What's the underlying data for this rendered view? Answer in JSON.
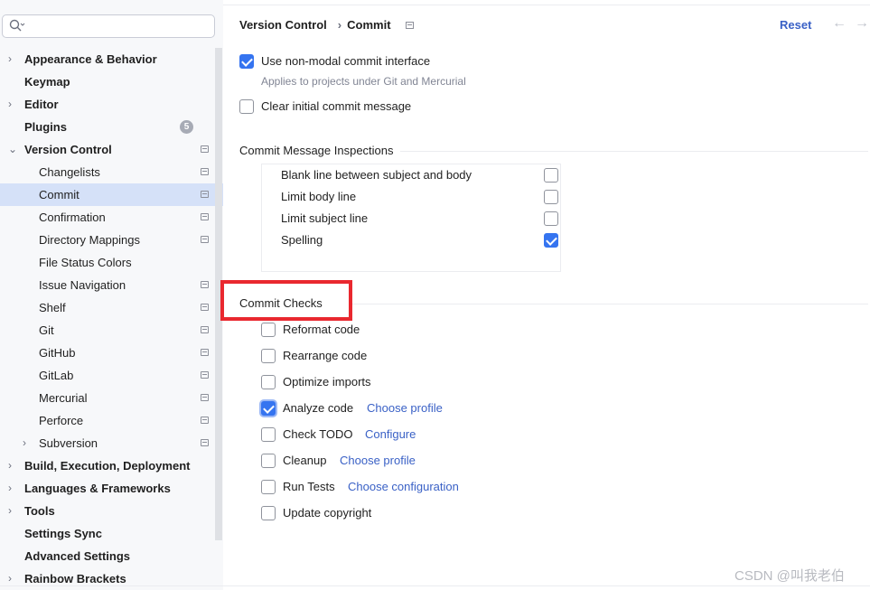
{
  "search": {
    "placeholder": ""
  },
  "tree": [
    {
      "label": "Appearance & Behavior",
      "level": 0,
      "chevron": true
    },
    {
      "label": "Keymap",
      "level": 0
    },
    {
      "label": "Editor",
      "level": 0,
      "chevron": true
    },
    {
      "label": "Plugins",
      "level": 0,
      "badge": "5"
    },
    {
      "label": "Version Control",
      "level": 0,
      "expanded": true,
      "page_icon": true
    },
    {
      "label": "Changelists",
      "level": 1,
      "page_icon": true
    },
    {
      "label": "Commit",
      "level": 1,
      "page_icon": true,
      "selected": true
    },
    {
      "label": "Confirmation",
      "level": 1,
      "page_icon": true
    },
    {
      "label": "Directory Mappings",
      "level": 1,
      "page_icon": true
    },
    {
      "label": "File Status Colors",
      "level": 1
    },
    {
      "label": "Issue Navigation",
      "level": 1,
      "page_icon": true
    },
    {
      "label": "Shelf",
      "level": 1,
      "page_icon": true
    },
    {
      "label": "Git",
      "level": 1,
      "page_icon": true
    },
    {
      "label": "GitHub",
      "level": 1,
      "page_icon": true
    },
    {
      "label": "GitLab",
      "level": 1,
      "page_icon": true
    },
    {
      "label": "Mercurial",
      "level": 1,
      "page_icon": true
    },
    {
      "label": "Perforce",
      "level": 1,
      "page_icon": true
    },
    {
      "label": "Subversion",
      "level": 1,
      "chevron": true,
      "page_icon": true
    },
    {
      "label": "Build, Execution, Deployment",
      "level": 0,
      "chevron": true
    },
    {
      "label": "Languages & Frameworks",
      "level": 0,
      "chevron": true
    },
    {
      "label": "Tools",
      "level": 0,
      "chevron": true
    },
    {
      "label": "Settings Sync",
      "level": 0
    },
    {
      "label": "Advanced Settings",
      "level": 0
    },
    {
      "label": "Rainbow Brackets",
      "level": 0,
      "chevron": true
    }
  ],
  "header": {
    "crumb_parent": "Version Control",
    "crumb_separator": "›",
    "crumb_current": "Commit",
    "reset": "Reset",
    "back_icon": "←",
    "forward_icon": "→"
  },
  "options": {
    "non_modal": {
      "label": "Use non-modal commit interface",
      "checked": true,
      "hint": "Applies to projects under Git and Mercurial"
    },
    "clear_initial": {
      "label": "Clear initial commit message",
      "checked": false
    }
  },
  "inspections": {
    "title": "Commit Message Inspections",
    "items": [
      {
        "label": "Blank line between subject and body",
        "checked": false
      },
      {
        "label": "Limit body line",
        "checked": false
      },
      {
        "label": "Limit subject line",
        "checked": false
      },
      {
        "label": "Spelling",
        "checked": true
      }
    ]
  },
  "checks": {
    "title": "Commit Checks",
    "items": [
      {
        "label": "Reformat code",
        "checked": false,
        "link": ""
      },
      {
        "label": "Rearrange code",
        "checked": false,
        "link": ""
      },
      {
        "label": "Optimize imports",
        "checked": false,
        "link": ""
      },
      {
        "label": "Analyze code",
        "checked": true,
        "link": "Choose profile"
      },
      {
        "label": "Check TODO",
        "checked": false,
        "link": "Configure"
      },
      {
        "label": "Cleanup",
        "checked": false,
        "link": "Choose profile"
      },
      {
        "label": "Run Tests",
        "checked": false,
        "link": "Choose configuration"
      },
      {
        "label": "Update copyright",
        "checked": false,
        "link": ""
      }
    ]
  },
  "watermark": "CSDN @叫我老伯",
  "colors": {
    "accent": "#3574f0",
    "link": "#3a61c6",
    "selection": "#d5e1f8",
    "highlight": "#e9282f"
  }
}
